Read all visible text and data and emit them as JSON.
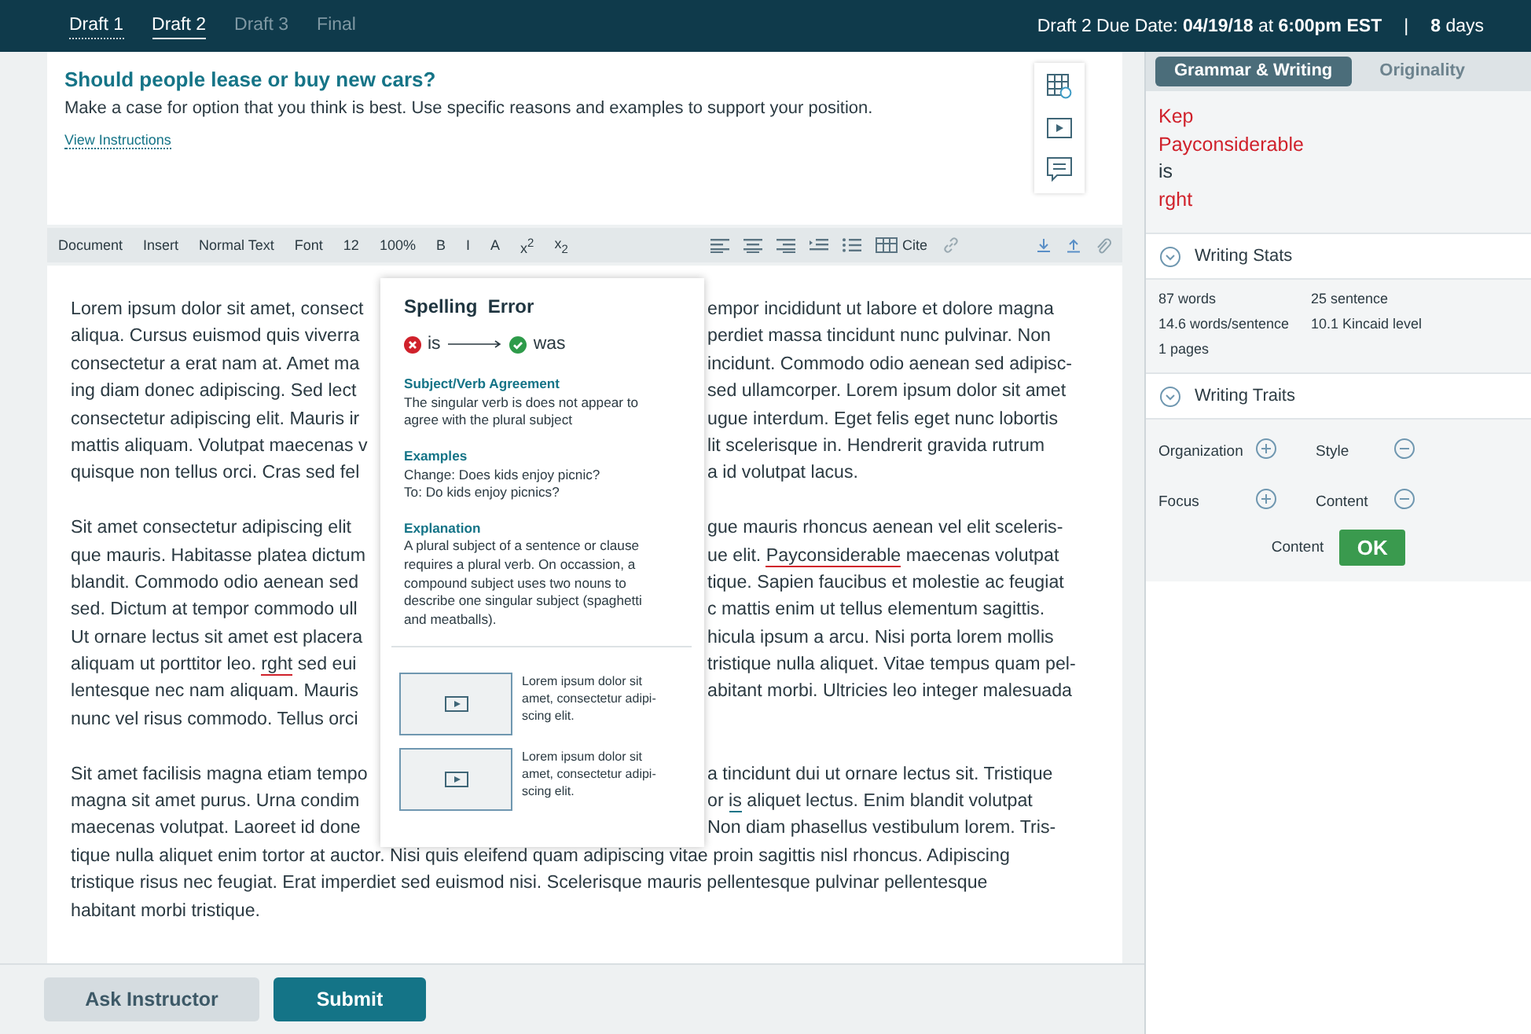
{
  "drafts": [
    {
      "label": "Draft 1",
      "selected": false,
      "disabled": false
    },
    {
      "label": "Draft 2",
      "selected": true,
      "disabled": false
    },
    {
      "label": "Draft 3",
      "selected": false,
      "disabled": true
    },
    {
      "label": "Final",
      "selected": false,
      "disabled": true
    }
  ],
  "due": {
    "text": "Draft 2 Due Date: **04/19/18**  at  **6:00pm  EST**",
    "separator": "|",
    "days": "**8** days"
  },
  "prompt": {
    "title": "Should people lease or buy new cars?",
    "text": "Make a case for option that you think is best. Use specific reasons and examples to support your position.",
    "link": "View Instructions"
  },
  "toolbar": {
    "items": [
      "Document",
      "Insert",
      "Normal Text",
      "Font",
      "12",
      "100%",
      "B",
      "I",
      "A",
      "x$^{2}$",
      "x$_{2}$"
    ],
    "cite": "Cite"
  },
  "essay": [
    {
      "left": "Lorem ipsum dolor sit amet, consect",
      "right": "empor incididunt ut labore et dolore magna"
    },
    {
      "left": "aliqua. Cursus euismod quis viverra",
      "right": "perdiet massa tincidunt nunc pulvinar. Non"
    },
    {
      "left": "consectetur a erat nam at. Amet ma",
      "right": "incidunt. Commodo odio aenean sed adipisc-"
    },
    {
      "left": "ing diam donec adipiscing. Sed lect",
      "right": "sed ullamcorper. Lorem ipsum dolor sit amet"
    },
    {
      "left": "consectetur adipiscing elit. Mauris ir",
      "right": "ugue interdum. Eget felis eget nunc lobortis"
    },
    {
      "left": "mattis aliquam. Volutpat maecenas v",
      "right": "lit scelerisque in. Hendrerit gravida rutrum"
    },
    {
      "left": "quisque non tellus orci. Cras sed fel",
      "right": "a id volutpat lacus."
    },
    {
      "kind": "break"
    },
    {
      "left": "Sit amet consectetur adipiscing elit",
      "right": "gue mauris rhoncus aenean vel elit sceleris-"
    },
    {
      "left": "que mauris. Habitasse platea dictum",
      "right": [
        {
          "text": "ue elit. "
        },
        {
          "text": "Payconsiderable",
          "kind": "spelling"
        },
        {
          "text": " maecenas volutpat"
        }
      ]
    },
    {
      "left": "blandit. Commodo odio aenean sed",
      "right": "tique. Sapien faucibus et molestie ac feugiat"
    },
    {
      "left": "sed. Dictum at tempor commodo ull",
      "right": "c mattis enim ut tellus elementum sagittis."
    },
    {
      "left": "Ut ornare lectus sit amet est placera",
      "right": "hicula ipsum a arcu. Nisi porta lorem mollis"
    },
    {
      "left": [
        {
          "text": "aliquam ut porttitor leo. "
        },
        {
          "text": "rght",
          "kind": "spelling"
        },
        {
          "text": " sed eui"
        }
      ],
      "right": "tristique nulla aliquet. Vitae tempus quam pel-"
    },
    {
      "left": "lentesque nec nam aliquam. Mauris",
      "right": "abitant morbi. Ultricies leo integer malesuada"
    },
    {
      "left": "nunc vel risus commodo. Tellus orci"
    },
    {
      "kind": "break"
    },
    {
      "left": "Sit amet facilisis magna etiam tempo",
      "right": "a tincidunt dui ut ornare lectus sit. Tristique"
    },
    {
      "left": "magna sit amet purus. Urna condim",
      "right": [
        {
          "text": "or "
        },
        {
          "text": "is",
          "kind": "grammar"
        },
        {
          "text": " aliquet lectus. Enim blandit volutpat"
        }
      ]
    },
    {
      "left": "maecenas volutpat. Laoreet id done",
      "right": "Non diam phasellus vestibulum lorem. Tris-"
    },
    {
      "left": "tique nulla aliquet enim tortor at auctor. Nisi quis eleifend quam adipiscing vitae proin sagittis nisl rhoncus. Adipiscing"
    },
    {
      "left": "tristique risus nec feugiat. Erat imperdiet sed euismod nisi. Scelerisque mauris pellentesque pulvinar pellentesque"
    },
    {
      "left": "habitant morbi tristique."
    }
  ],
  "popup": {
    "title": "Spelling  Error",
    "wrong": "is",
    "right": "was",
    "sections": [
      {
        "heading": "Subject/Verb Agreement",
        "text": "The singular verb is does not appear to agree with the plural subject"
      },
      {
        "heading": "Examples",
        "text": "Change: Does kids enjoy picnic?\nTo: Do kids enjoy picnics?"
      },
      {
        "heading": "Explanation",
        "text": "A plural subject of a sentence or clause requires a plural verb. On occassion, a compound subject uses two nouns to describe one singular subject (spaghetti and meatballs)."
      }
    ],
    "videos": [
      {
        "caption": "Lorem ipsum dolor sit amet, consectetur adipi-scing elit."
      },
      {
        "caption": "Lorem ipsum dolor sit amet, consectetur adipi-scing elit."
      }
    ]
  },
  "panel": {
    "tabs": [
      {
        "label": "Grammar & Writing",
        "selected": true
      },
      {
        "label": "Originality",
        "selected": false
      }
    ],
    "errors": [
      {
        "word": "Kep",
        "color": "#d0212b"
      },
      {
        "word": "Payconsiderable",
        "color": "#d0212b"
      },
      {
        "word": "is",
        "color": "#2b3a42"
      },
      {
        "word": "rght",
        "color": "#d0212b"
      }
    ],
    "stats_title": "Writing Stats",
    "expanded_stats": true,
    "stats": [
      "87 words",
      "25 sentence",
      "14.6 words/sentence",
      "10.1 Kincaid level",
      "1 pages"
    ],
    "traits_title": "Writing Traits",
    "expanded_traits": true,
    "traits": [
      {
        "label": "Organization",
        "kind": "plus"
      },
      {
        "label": "Style",
        "kind": "minus"
      },
      {
        "label": "Focus",
        "kind": "plus"
      },
      {
        "label": "Content",
        "kind": "minus"
      }
    ],
    "verdict": {
      "label": "Content",
      "button": "OK"
    }
  },
  "footer": {
    "buttons": [
      {
        "label": "Ask Instructor",
        "kind": "secondary"
      },
      {
        "label": "Submit",
        "kind": "primary"
      }
    ]
  }
}
